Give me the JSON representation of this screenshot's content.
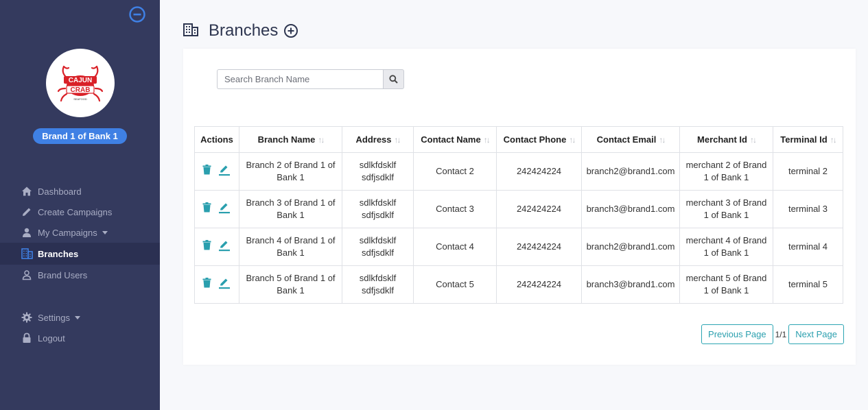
{
  "sidebar": {
    "brand_name": "Brand 1 of Bank 1",
    "logo": {
      "text_top": "CAJUN",
      "text_bottom": "CRAB",
      "tagline": "SEAFOOD"
    },
    "nav": [
      {
        "label": "Dashboard",
        "icon": "home-icon"
      },
      {
        "label": "Create Campaigns",
        "icon": "pencil-icon"
      },
      {
        "label": "My Campaigns",
        "icon": "user-icon"
      },
      {
        "label": "Branches",
        "icon": "building-icon"
      },
      {
        "label": "Brand Users",
        "icon": "user-outline-icon"
      }
    ],
    "nav_bottom": [
      {
        "label": "Settings",
        "icon": "gear-icon"
      },
      {
        "label": "Logout",
        "icon": "lock-icon"
      }
    ]
  },
  "page": {
    "title": "Branches"
  },
  "search": {
    "placeholder": "Search Branch Name",
    "value": ""
  },
  "table": {
    "headers": [
      "Actions",
      "Branch Name",
      "Address",
      "Contact Name",
      "Contact Phone",
      "Contact Email",
      "Merchant Id",
      "Terminal Id"
    ],
    "rows": [
      {
        "branch_name": "Branch 2 of Brand 1 of Bank 1",
        "address": "sdlkfdsklf sdfjsdklf",
        "contact_name": "Contact 2",
        "contact_phone": "242424224",
        "contact_email": "branch2@brand1.com",
        "merchant_id": "merchant 2 of Brand 1 of Bank 1",
        "terminal_id": "terminal 2"
      },
      {
        "branch_name": "Branch 3 of Brand 1 of Bank 1",
        "address": "sdlkfdsklf sdfjsdklf",
        "contact_name": "Contact 3",
        "contact_phone": "242424224",
        "contact_email": "branch3@brand1.com",
        "merchant_id": "merchant 3 of Brand 1 of Bank 1",
        "terminal_id": "terminal 3"
      },
      {
        "branch_name": "Branch 4 of Brand 1 of Bank 1",
        "address": "sdlkfdsklf sdfjsdklf",
        "contact_name": "Contact 4",
        "contact_phone": "242424224",
        "contact_email": "branch2@brand1.com",
        "merchant_id": "merchant 4 of Brand 1 of Bank 1",
        "terminal_id": "terminal 4"
      },
      {
        "branch_name": "Branch 5 of Brand 1 of Bank 1",
        "address": "sdlkfdsklf sdfjsdklf",
        "contact_name": "Contact 5",
        "contact_phone": "242424224",
        "contact_email": "branch3@brand1.com",
        "merchant_id": "merchant 5 of Brand 1 of Bank 1",
        "terminal_id": "terminal 5"
      }
    ]
  },
  "pagination": {
    "prev_label": "Previous Page",
    "next_label": "Next Page",
    "info": "1/1"
  },
  "colors": {
    "sidebar_bg": "#343a5e",
    "accent_blue": "#3f80e4",
    "teal": "#2a9fae",
    "title": "#2e3650"
  }
}
